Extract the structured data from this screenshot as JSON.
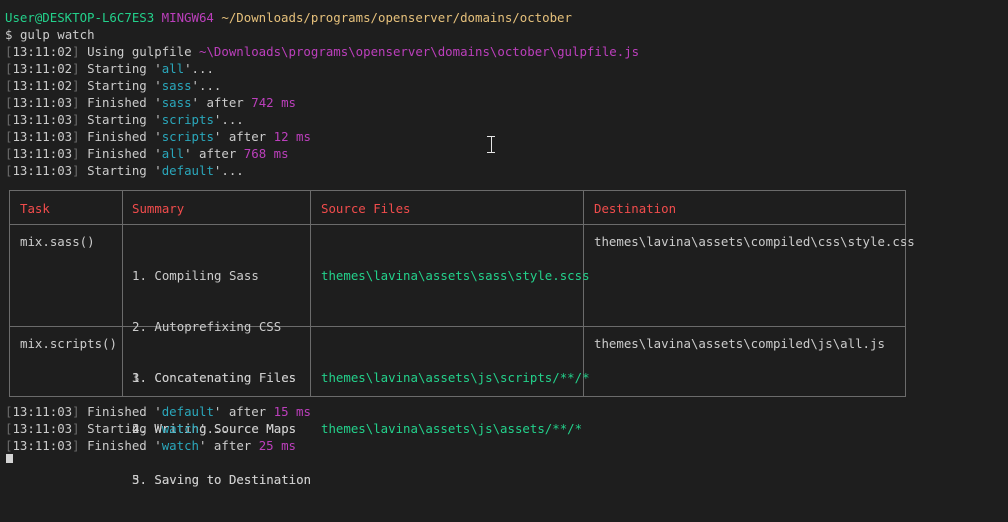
{
  "prompt": {
    "user": "User@DESKTOP-L6C7ES3",
    "env": "MINGW64",
    "path": "~/Downloads/programs/openserver/domains/october",
    "symbol": "$",
    "command": "gulp watch"
  },
  "log_top": [
    {
      "time": "13:11:02",
      "pre": "Using gulpfile ",
      "hl": "~\\Downloads\\programs\\openserver\\domains\\october\\gulpfile.js",
      "hl_class": "gulppath",
      "mid": "",
      "num": "",
      "post": ""
    },
    {
      "time": "13:11:02",
      "pre": "Starting '",
      "hl": "all",
      "hl_class": "cyan",
      "mid": "'...",
      "num": "",
      "post": ""
    },
    {
      "time": "13:11:02",
      "pre": "Starting '",
      "hl": "sass",
      "hl_class": "cyan",
      "mid": "'...",
      "num": "",
      "post": ""
    },
    {
      "time": "13:11:03",
      "pre": "Finished '",
      "hl": "sass",
      "hl_class": "cyan",
      "mid": "' after ",
      "num": "742 ms",
      "post": ""
    },
    {
      "time": "13:11:03",
      "pre": "Starting '",
      "hl": "scripts",
      "hl_class": "cyan",
      "mid": "'...",
      "num": "",
      "post": ""
    },
    {
      "time": "13:11:03",
      "pre": "Finished '",
      "hl": "scripts",
      "hl_class": "cyan",
      "mid": "' after ",
      "num": "12 ms",
      "post": ""
    },
    {
      "time": "13:11:03",
      "pre": "Finished '",
      "hl": "all",
      "hl_class": "cyan",
      "mid": "' after ",
      "num": "768 ms",
      "post": ""
    },
    {
      "time": "13:11:03",
      "pre": "Starting '",
      "hl": "default",
      "hl_class": "cyan",
      "mid": "'...",
      "num": "",
      "post": ""
    }
  ],
  "table": {
    "headers": [
      "Task",
      "Summary",
      "Source Files",
      "Destination"
    ],
    "rows": [
      {
        "task": "mix.sass()",
        "summary": [
          "1. Compiling Sass",
          "2. Autoprefixing CSS",
          "3. Concatenating Files",
          "4. Writing Source Maps",
          "5. Saving to Destination"
        ],
        "sources": [
          "themes\\lavina\\assets\\sass\\style.scss"
        ],
        "destination": "themes\\lavina\\assets\\compiled\\css\\style.css"
      },
      {
        "task": "mix.scripts()",
        "summary": [
          "1. Concatenating Files",
          "2. Writing Source Maps",
          "3. Saving to Destination"
        ],
        "sources": [
          "themes\\lavina\\assets\\js\\scripts/**/*",
          "themes\\lavina\\assets\\js\\assets/**/*"
        ],
        "destination": "themes\\lavina\\assets\\compiled\\js\\all.js"
      }
    ]
  },
  "log_bottom": [
    {
      "time": "13:11:03",
      "pre": "Finished '",
      "hl": "default",
      "hl_class": "cyan",
      "mid": "' after ",
      "num": "15 ms",
      "post": ""
    },
    {
      "time": "13:11:03",
      "pre": "Starting '",
      "hl": "watch",
      "hl_class": "cyan",
      "mid": "'...",
      "num": "",
      "post": ""
    },
    {
      "time": "13:11:03",
      "pre": "Finished '",
      "hl": "watch",
      "hl_class": "cyan",
      "mid": "' after ",
      "num": "25 ms",
      "post": ""
    }
  ],
  "icons": {
    "text_cursor": "ibeam-cursor-icon",
    "terminal_cursor": "block-cursor-icon"
  }
}
